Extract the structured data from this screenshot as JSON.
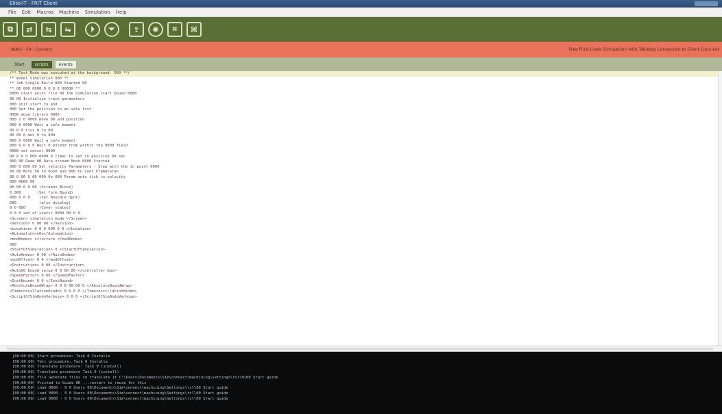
{
  "window": {
    "title": "EliteHT - FRIT Client"
  },
  "menu": {
    "items": [
      "File",
      "Edit",
      "Macros",
      "Machine",
      "Simulation",
      "Help"
    ]
  },
  "toolbar": {
    "icons": [
      {
        "name": "new-file-icon",
        "glyph": "⧉"
      },
      {
        "name": "open-file-icon",
        "glyph": "⇄"
      },
      {
        "name": "save-icon",
        "glyph": "⇆"
      },
      {
        "name": "save-as-icon",
        "glyph": "⇋"
      },
      {
        "name": "run-icon",
        "glyph": "⏵"
      },
      {
        "name": "stop-icon",
        "glyph": "⏷"
      },
      {
        "name": "upload-icon",
        "glyph": "⇪"
      },
      {
        "name": "settings-icon",
        "glyph": "✺"
      },
      {
        "name": "connect-icon",
        "glyph": "⌗"
      },
      {
        "name": "macro-icon",
        "glyph": "⌘"
      }
    ]
  },
  "status": {
    "left": "NIAIS - 54 - Connect",
    "right": "Free Fluid Lines (Simulation) with Tabletop Connection to Client Conn ent"
  },
  "tabs": [
    {
      "label": "Start",
      "style": "plain"
    },
    {
      "label": "scripts",
      "style": "active"
    },
    {
      "label": "events",
      "style": "light"
    }
  ],
  "editor": {
    "lines": [
      {
        "text": "/** Test Mode was executed at the background  000 **/",
        "bold": false
      },
      {
        "text": "** model Simulation 000 **",
        "bold": false
      },
      {
        "text": "** Job Single Build 000 Started 00",
        "bold": false
      },
      {
        "text": "** 00 000 0000 0 0 0 0 00000 **",
        "bold": false
      },
      {
        "text": "0000 start point file 00 The Simulation start bound 0000",
        "bold": false
      },
      {
        "text": "00 00 Initialize track parameters",
        "bold": false
      },
      {
        "text": "000 Init start to end",
        "bold": false
      },
      {
        "text": "000 Set the position to an idle frst",
        "bold": false
      },
      {
        "text": "0000 move library 0000",
        "bold": false
      },
      {
        "text": "000 Z 0 9000 move 00 and position",
        "bold": false
      },
      {
        "text": "000 0 0000 Wait a safe moment",
        "bold": false
      },
      {
        "text": "00 0 0 tiss 0 to 00",
        "bold": false
      },
      {
        "text": "00 00 0 mov 0 to 000",
        "bold": false
      },
      {
        "text": "000 0 0000 Wait a safe moment",
        "bold": false
      },
      {
        "text": "000 0 0 0 0 Wait 0 extend from within the 0000 field",
        "bold": false
      },
      {
        "text": "0000 set sensor 0000",
        "bold": false
      },
      {
        "text": "00 0 0 0 000 0000 0 Timer to set in position 00 sec",
        "bold": false
      },
      {
        "text": "000 00 Read 00 Data stream 0ooh 0000 Started",
        "bold": false
      },
      {
        "text": "000 0 000 00 Set velocity Parameters - Step with the in point 0000",
        "bold": false
      },
      {
        "text": "00 00 Moto 00 to 0ooh and 000 to cont Frameteran",
        "bold": false
      },
      {
        "text": "00 0 00 0 00 000 0o 000 Feram auto tisk to velocity",
        "bold": false
      },
      {
        "text": "000 0000 00",
        "bold": false
      },
      {
        "text": "00 00 0 0 00 (Screens Block)",
        "bold": false
      },
      {
        "text": "0 000       (Set form Bound)",
        "bold": false
      },
      {
        "text": "000 0 0 0    (Set Boundle Spot)",
        "bold": false
      },
      {
        "text": "000          (also display)",
        "bold": false
      },
      {
        "text": "0 0 000      (Cover states)",
        "bold": false
      },
      {
        "text": "0 0 0 set of static 0000 00 0 0",
        "bold": false
      },
      {
        "text": "<Screen> simulation mode </Screen>",
        "bold": false
      },
      {
        "text": "<Version> 0 00 00 </Version>",
        "bold": false
      },
      {
        "text": "<Location> 0 0 0 000 0 0 </Location>",
        "bold": false
      },
      {
        "text": "<Automation>o0o</Automation>",
        "bold": false
      },
      {
        "text": "<mod0ndex> structure </mod0ndex>",
        "bold": false
      },
      {
        "text": "000",
        "bold": false
      },
      {
        "text": "<StartOfSimulation> 0 </StartOfSimulation>",
        "bold": false
      },
      {
        "text": "<Auto0ndex> 0 00 </Auto0ndex>",
        "bold": false
      },
      {
        "text": "<modOffset> 0 0 </modOffset>",
        "bold": false
      },
      {
        "text": "<Instruction> 0 00 </Instruction>",
        "bold": false
      },
      {
        "text": "<Auto00 bound setup 0 0 00 00 </controller bps>",
        "bold": false
      },
      {
        "text": "<SpeedFactor> 0 00 </SpeedFactor>",
        "bold": false
      },
      {
        "text": "<InstBound> 0 0 </InstBound>",
        "bold": false
      },
      {
        "text": "<AbsoluteBoundWrap> 0 0 0 00 00 0 </AbsoluteBoundWrap>",
        "bold": false
      },
      {
        "text": "<Timeroscillation0indo> 0 0 0 0 </Timeroscillation0indo>",
        "bold": false
      },
      {
        "text": "<ScriptOfSimOndoVerbose> 0 0 0 </ScriptOfSimOndoVerbose>",
        "bold": false
      }
    ]
  },
  "console": {
    "lines": [
      "[00:00:00] Start procedure: Task 0 Installe",
      "[00:00:00] Fetc procedure: Task 0 Installe",
      "[00:00:00] Translate procedure: Task 0 (install)",
      "[00:00:00] Translate procedure Task 0 (install)",
      "[00:00:00] File Generate files to translate it C:\\Users\\Documents\\Sim\\connect\\machining\\settings\\rsl\\0\\00 Start guide",
      "[00:00:00] Printed to Guide OK ...restart to reuse for this",
      "[00:00:00] Load 0000 - 0 0 Users 00\\Documents\\Sim\\connect\\machining\\Settings\\rsl\\00 Start guide",
      "[00:00:00] Load 0000 - 0 0 Users 00\\Documents\\Sim\\connect\\machining\\Settings\\rsl\\00 Start guide",
      "[00:00:00] Load 0000 - 0 0 Users 00\\Documents\\Sim\\connect\\machining\\Settings\\rsl\\00 Start guide"
    ]
  },
  "colors": {
    "toolbar_bg": "#5a6f33",
    "status_bg": "#e8735a",
    "tabs_bg": "#b3b89a",
    "active_tab": "#4d5e2b",
    "console_bg": "#0b0b0b"
  }
}
